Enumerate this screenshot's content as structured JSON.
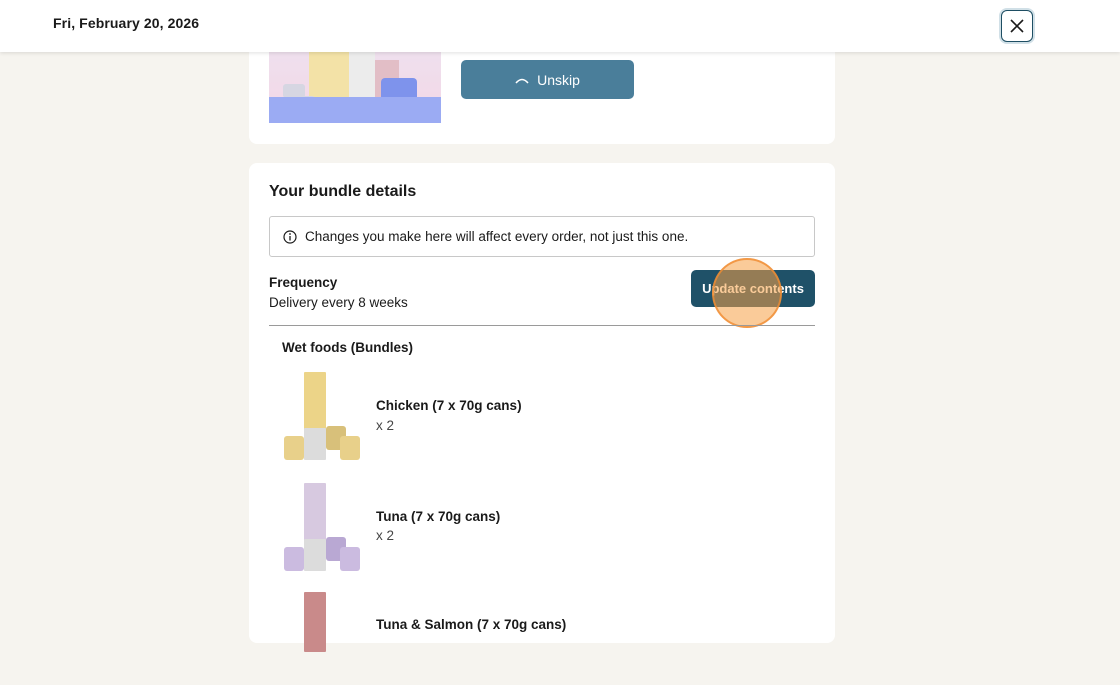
{
  "header": {
    "date": "Fri, February 20, 2026",
    "close_icon": "close-icon"
  },
  "skip_card": {
    "unskip_label": "Unskip",
    "unskip_icon": "arc-arrow-icon"
  },
  "bundle": {
    "title": "Your bundle details",
    "notice": "Changes you make here will affect every order, not just this one.",
    "notice_icon": "info-icon",
    "frequency_label": "Frequency",
    "frequency_value": "Delivery every 8 weeks",
    "update_label": "Update contents",
    "section_title": "Wet foods (Bundles)",
    "items": [
      {
        "name": "Chicken (7 x 70g cans)",
        "qty": "x 2"
      },
      {
        "name": "Tuna (7 x 70g cans)",
        "qty": "x 2"
      },
      {
        "name": "Tuna & Salmon (7 x 70g cans)",
        "qty": ""
      }
    ]
  },
  "colors": {
    "primary_button": "#1f5168",
    "unskip_button": "#4a7e9a",
    "background": "#f6f4ef",
    "click_marker": "#f5a046"
  }
}
